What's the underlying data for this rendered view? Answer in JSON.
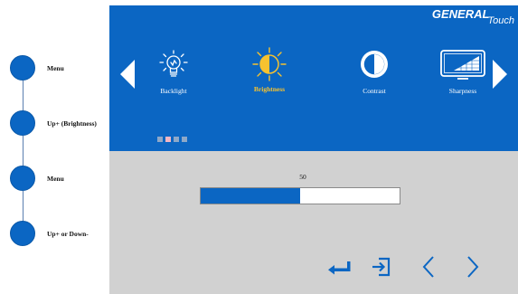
{
  "left_steps": [
    {
      "label": "Menu"
    },
    {
      "label": "Up+ (Brightness)"
    },
    {
      "label": "Menu"
    },
    {
      "label": "Up+ or Down-"
    }
  ],
  "brand": {
    "part1": "GENERAL",
    "part2": "Touch"
  },
  "menu": {
    "items": [
      {
        "label": "Backlight",
        "icon": "bulb-icon"
      },
      {
        "label": "Brightness",
        "icon": "sun-icon",
        "selected": true
      },
      {
        "label": "Contrast",
        "icon": "contrast-icon"
      },
      {
        "label": "Sharpness",
        "icon": "monitor-sharpness-icon"
      }
    ],
    "page_indicator": {
      "pages": 4,
      "current": 1
    }
  },
  "slider": {
    "value": "50",
    "level": 0.5
  },
  "controls": [
    "enter-icon",
    "exit-icon",
    "chevron-left-icon",
    "chevron-right-icon"
  ],
  "colors": {
    "osd_blue": "#0b66c3",
    "highlight": "#f6c22f",
    "panel_grey": "#d1d1d1"
  }
}
